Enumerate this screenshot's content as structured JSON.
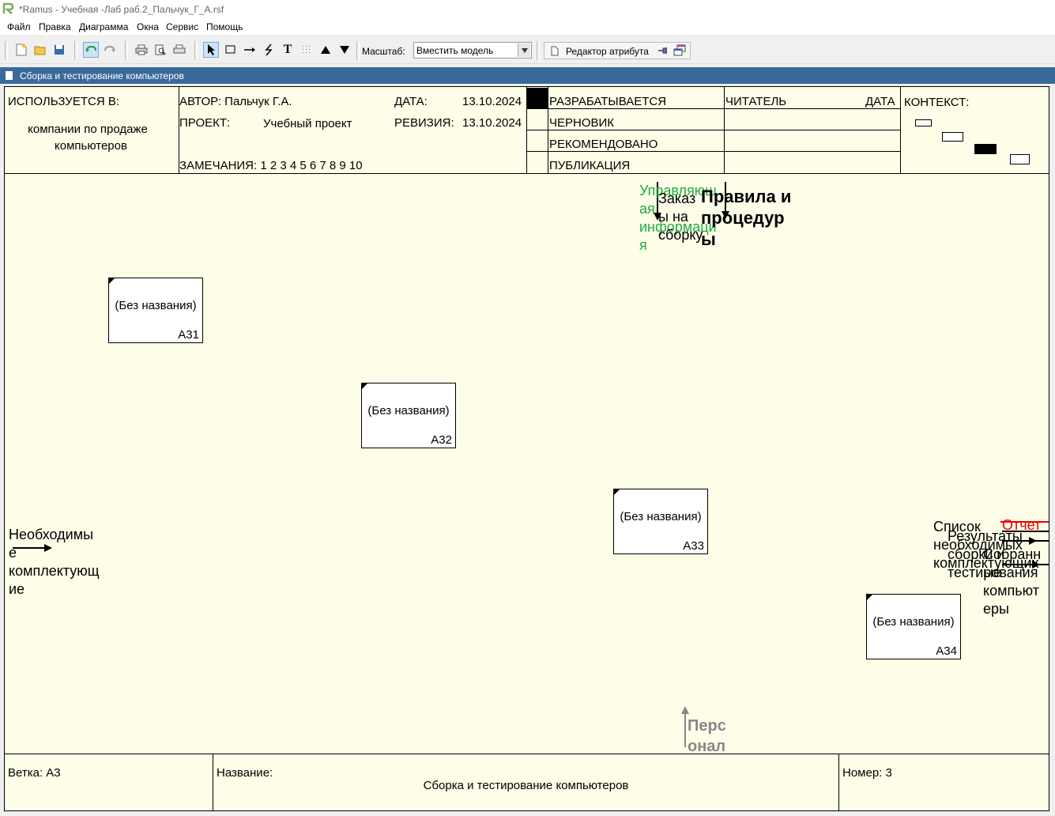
{
  "window": {
    "title": "*Ramus - Учебная -Лаб  раб.2_Пальчук_Г_А.rsf"
  },
  "menu": [
    "Файл",
    "Правка",
    "Диаграмма",
    "Окна",
    "Сервис",
    "Помощь"
  ],
  "toolbar": {
    "icons": [
      "new-icon",
      "open-icon",
      "save-icon",
      "undo-icon",
      "redo-icon",
      "print-icon",
      "print-preview-icon",
      "page-setup-icon",
      "pointer-icon",
      "rectangle-icon",
      "arrow-icon",
      "squiggle-icon",
      "text-icon",
      "dots-icon",
      "up-icon",
      "down-icon"
    ],
    "zoom_label": "Масштаб:",
    "zoom_value": "Вместить модель",
    "attr_editor_label": "Редактор атрибута"
  },
  "document_tab": {
    "title": "Сборка и тестирование компьютеров"
  },
  "header": {
    "used_in_label": "ИСПОЛЬЗУЕТСЯ В:",
    "used_in_value_1": "компании по продаже",
    "used_in_value_2": "компьютеров",
    "author_label": "АВТОР: Пальчук Г.А.",
    "project_label": "ПРОЕКТ:",
    "project_value": "Учебный проект",
    "notes_label": "ЗАМЕЧАНИЯ: 1 2 3 4 5 6 7 8 9 10",
    "date_label": "ДАТА:",
    "date_value": "13.10.2024",
    "revision_label": "РЕВИЗИЯ:",
    "revision_value": "13.10.2024",
    "status_1": "РАЗРАБАТЫВАЕТСЯ",
    "status_2": "ЧЕРНОВИК",
    "status_3": "РЕКОМЕНДОВАНО",
    "status_4": "ПУБЛИКАЦИЯ",
    "reader_label": "ЧИТАТЕЛЬ",
    "reader_date_label": "ДАТА",
    "context_label": "КОНТЕКСТ:"
  },
  "boxes": [
    {
      "name": "(Без названия)",
      "id": "A31"
    },
    {
      "name": "(Без названия)",
      "id": "A32"
    },
    {
      "name": "(Без названия)",
      "id": "A33"
    },
    {
      "name": "(Без названия)",
      "id": "A34"
    }
  ],
  "arrow_labels": {
    "control_info": "Управляющ\nая\nинформаци\nя",
    "order": "Заказ\nы на\nсборку",
    "rules": "Правила и\nпроцедур\nы",
    "input": "Необходимы\nе\nкомплектующ\nие",
    "list": "Список\nнеобходимых\nкомплектующих",
    "report": "Отчет",
    "results": "Результаты\nсборки и\nтестирования",
    "assembled": "Собранн\nые\nкомпьют\nеры",
    "staff": "Перс\nонал"
  },
  "colors": {
    "control_info": "#22aa44",
    "report": "#ee0000",
    "staff": "#888888",
    "canvas": "#fdfde8",
    "doc_tab": "#3a6a9a"
  },
  "footer": {
    "node_label": "Ветка: А3",
    "name_label": "Название:",
    "name_value": "Сборка и тестирование компьютеров",
    "number_label": "Номер: 3"
  }
}
